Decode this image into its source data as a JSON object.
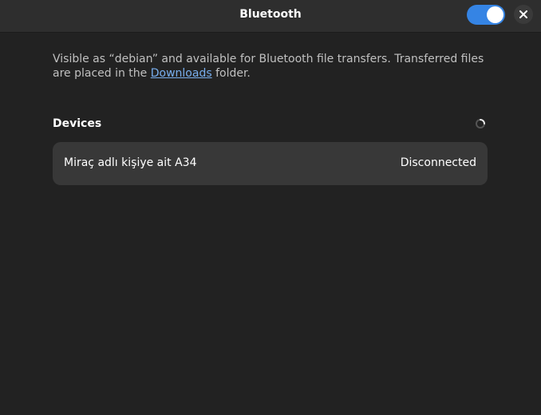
{
  "header": {
    "title": "Bluetooth",
    "switch_state": "on",
    "close_icon": "close-icon"
  },
  "explanation": {
    "text_before": "Visible as “debian” and available for Bluetooth file transfers. Transferred files are placed in the ",
    "link_text": "Downloads",
    "text_after": " folder."
  },
  "devices": {
    "label": "Devices",
    "spinner_icon": "spinner-icon",
    "items": [
      {
        "name": "Miraç adlı kişiye ait A34",
        "status": "Disconnected"
      }
    ]
  },
  "colors": {
    "accent": "#3584e4",
    "link": "#78aeed",
    "background": "#222222",
    "headerbar": "#2e2e2e",
    "row": "#383838"
  }
}
